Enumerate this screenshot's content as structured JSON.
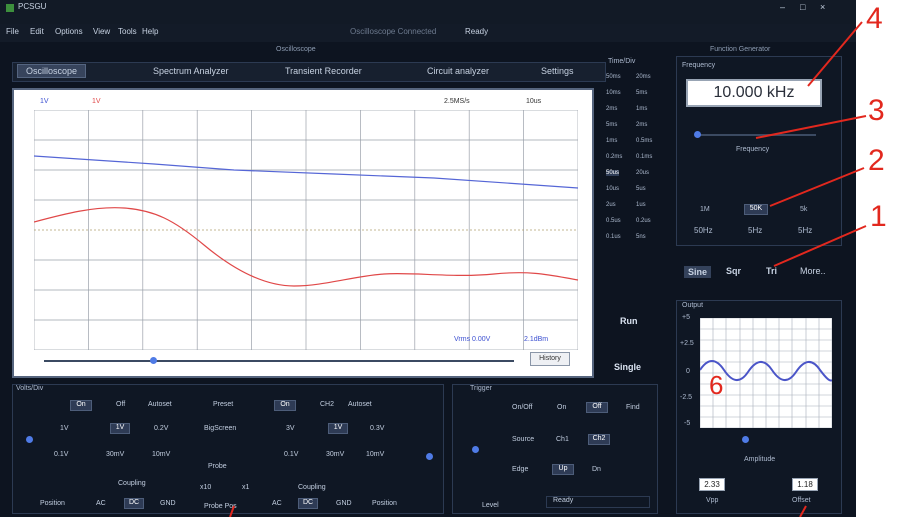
{
  "window": {
    "title": "PCSGU",
    "minimize": "–",
    "maximize": "□",
    "close": "×"
  },
  "menu": [
    "File",
    "Edit",
    "Options",
    "View",
    "Tools",
    "Help"
  ],
  "menu_center": [
    "Oscilloscope Connected",
    "Ready"
  ],
  "group_titles": {
    "oscilloscope": "Oscilloscope",
    "function_generator": "Function Generator"
  },
  "tabs": [
    "Oscilloscope",
    "Spectrum Analyzer",
    "Transient Recorder",
    "Circuit analyzer",
    "Settings"
  ],
  "scope": {
    "ch1_label": "1V",
    "ch2_label": "1V",
    "sample_rate": "2.5MS/s",
    "time_div": "10us",
    "vrms": "Vrms 0.00V",
    "freq_readout": "2.1dBm",
    "history": "History"
  },
  "time_div_list": {
    "title": "Time/Div",
    "items": [
      [
        "50ms",
        "20ms"
      ],
      [
        "10ms",
        "5ms"
      ],
      [
        "2ms",
        "1ms"
      ],
      [
        "5ms",
        "2ms"
      ],
      [
        "1ms",
        "0.5ms"
      ],
      [
        "0.2ms",
        "0.1ms"
      ],
      [
        "50us",
        "20us"
      ],
      [
        "10us",
        "5us"
      ],
      [
        "2us",
        "1us"
      ],
      [
        "0.5us",
        "0.2us"
      ],
      [
        "0.1us",
        "5ns"
      ]
    ],
    "selected": "50us"
  },
  "run": "Run",
  "single": "Single",
  "function_generator": {
    "frequency_title": "Frequency",
    "frequency_value": "10.000 kHz",
    "frequency_slider_label": "Frequency",
    "ranges": {
      "left_top": "1M",
      "left_bottom": "50Hz",
      "mid_top": "50K",
      "mid_bottom": "5Hz",
      "right_top": "5k",
      "right_bottom": "5Hz"
    },
    "wave_buttons": [
      "Sine",
      "Sqr",
      "Tri",
      "More.."
    ],
    "selected_wave": "Sine",
    "output_title": "Output",
    "y_ticks": [
      "+5",
      "+2.5",
      "0",
      "-2.5",
      "-5"
    ],
    "amplitude_label": "Amplitude",
    "vpp_value": "2.33",
    "vpp_label": "Vpp",
    "offset_value": "1.18",
    "offset_label": "Offset"
  },
  "volts_div": {
    "title": "Volts/Div",
    "ch1": {
      "on": "On",
      "off": "Off",
      "autoset": "Autoset",
      "v1": "1V",
      "v2": "1V",
      "v3": "0.2V",
      "v4": "0.1V",
      "v5": "30mV",
      "v6": "10mV"
    },
    "preset": "Preset",
    "big_screen": "BigScreen",
    "ch2": {
      "on": "On",
      "label": "CH2",
      "autoset": "Autoset",
      "v1": "3V",
      "v2": "1V",
      "v3": "0.3V",
      "v4": "0.1V",
      "v5": "30mV",
      "v6": "10mV"
    },
    "probe": "Probe",
    "probe_left": "x10",
    "probe_right": "x1",
    "probe_extra": "Probe Pos",
    "coupling": "Coupling",
    "position": "Position",
    "coupling_options": [
      "AC",
      "DC",
      "GND"
    ]
  },
  "trigger": {
    "title": "Trigger",
    "onoff_label": "On/Off",
    "on": "On",
    "off": "Off",
    "find": "Find",
    "source_label": "Source",
    "src1": "Ch1",
    "src2": "Ch2",
    "edge_label": "Edge",
    "up": "Up",
    "dn": "Dn",
    "level_label": "Level",
    "status": "Ready"
  },
  "annotations": [
    "4",
    "3",
    "2",
    "1",
    "6"
  ],
  "colors": {
    "ch1": "#3b4fd1",
    "ch2": "#e04848",
    "accent": "#4f7be6",
    "annotation": "#e2281e"
  }
}
